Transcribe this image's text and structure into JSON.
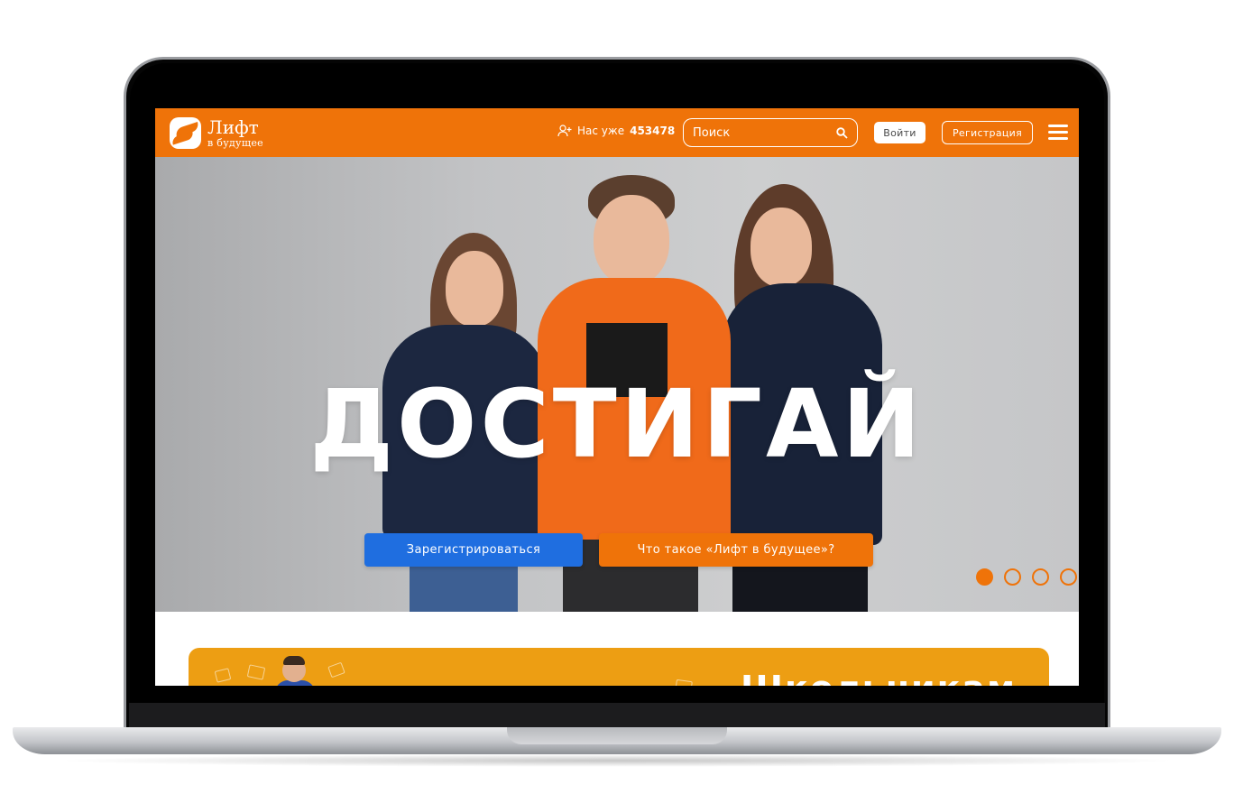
{
  "header": {
    "logo_title": "Лифт",
    "logo_subtitle": "в будущее",
    "users_label": "Нас уже",
    "users_count": "453478",
    "search_placeholder": "Поиск",
    "login_label": "Войти",
    "register_label": "Регистрация"
  },
  "hero": {
    "title": "ДОСТИГАЙ",
    "cta_primary": "Зарегистрироваться",
    "cta_secondary": "Что такое «Лифт в будущее»?",
    "slides_total": 4,
    "active_slide": 1
  },
  "banner": {
    "title": "Школьникам"
  },
  "colors": {
    "brand_orange": "#ef7309",
    "primary_blue": "#1f6ee0",
    "banner_yellow": "#ed9e13"
  },
  "icons": {
    "users": "user-plus-icon",
    "search": "search-icon",
    "menu": "hamburger-menu-icon"
  }
}
